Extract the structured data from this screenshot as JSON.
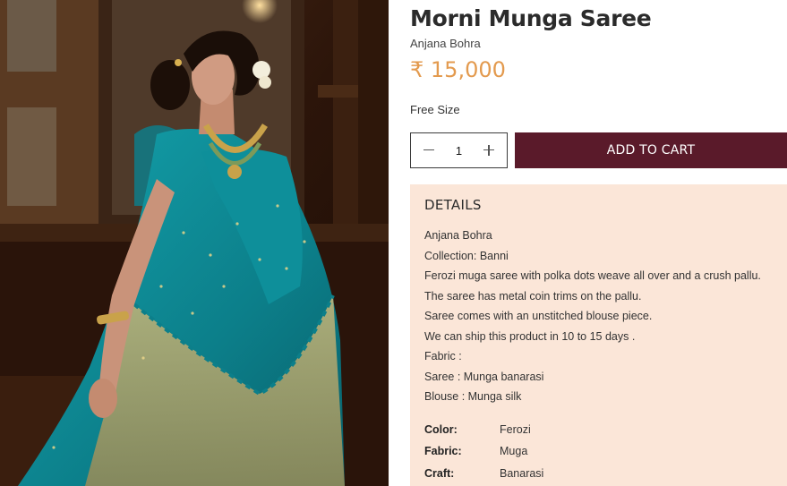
{
  "product": {
    "title": "Morni Munga Saree",
    "designer": "Anjana Bohra",
    "price": "₹ 15,000",
    "size": "Free Size",
    "image_alt": "Model wearing teal Morni Munga saree with gold necklace"
  },
  "cart": {
    "quantity": "1",
    "add_to_cart_label": "ADD TO CART"
  },
  "details": {
    "heading": "DETAILS",
    "lines": [
      "Anjana Bohra",
      "Collection: Banni",
      "Ferozi muga saree with polka dots weave all over and a crush pallu.",
      "The saree has metal coin trims on the pallu.",
      "Saree comes with an unstitched blouse piece.",
      "We can ship this product in 10 to 15 days .",
      "Fabric :",
      "Saree : Munga banarasi",
      "Blouse : Munga silk"
    ],
    "attributes": [
      {
        "key": "Color:",
        "value": "Ferozi"
      },
      {
        "key": "Fabric:",
        "value": "Muga"
      },
      {
        "key": "Craft:",
        "value": "Banarasi"
      }
    ]
  },
  "colors": {
    "price": "#e39a4e",
    "add_to_cart_bg": "#5a1a2a",
    "details_bg": "#fbe6d8",
    "saree_teal": "#0f8a94"
  },
  "icons": {
    "minus": "minus-icon",
    "plus": "plus-icon"
  }
}
